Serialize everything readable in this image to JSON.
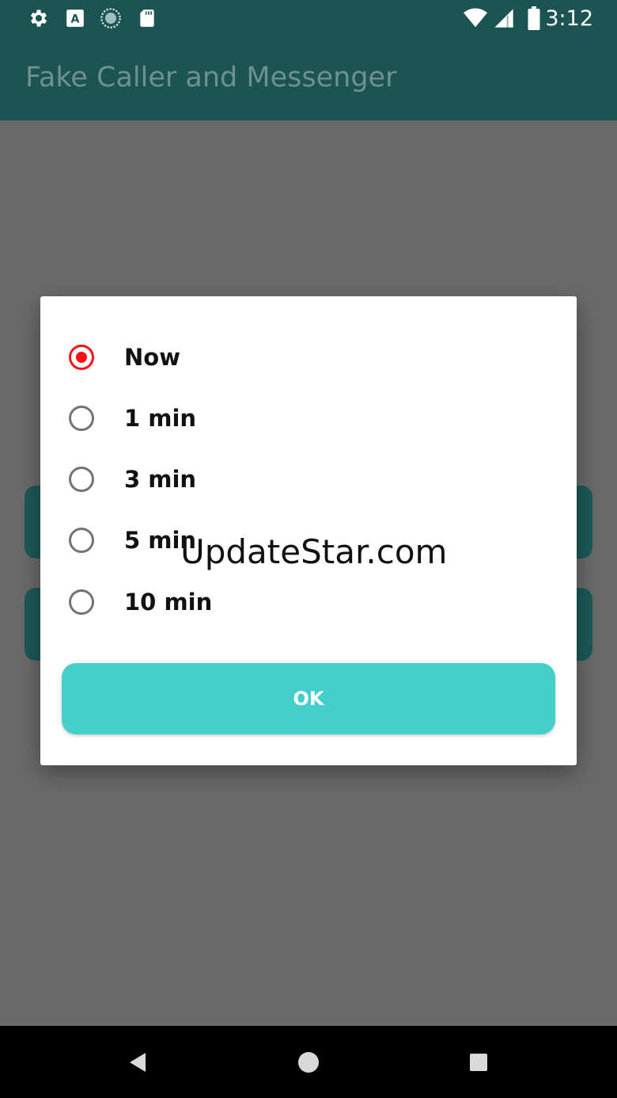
{
  "status_bar": {
    "time": "3:12",
    "icons": [
      "gear-icon",
      "a-text-icon",
      "sync-circle-icon",
      "sd-card-icon",
      "wifi-icon",
      "cell-signal-icon",
      "battery-icon"
    ]
  },
  "app_bar": {
    "title": "Fake Caller and Messenger"
  },
  "dialog": {
    "options": [
      {
        "label": "Now",
        "checked": true
      },
      {
        "label": "1 min",
        "checked": false
      },
      {
        "label": "3 min",
        "checked": false
      },
      {
        "label": "5 min",
        "checked": false
      },
      {
        "label": "10 min",
        "checked": false
      }
    ],
    "ok_label": "OK"
  },
  "watermark": "UpdateStar.com",
  "nav_bar": {
    "buttons": [
      "back-icon",
      "home-icon",
      "recents-icon"
    ]
  },
  "colors": {
    "app_bar": "#1b5453",
    "accent_radio": "#ff0f17",
    "ok_button": "#45cfcb",
    "scrim": "#6a6a6a"
  }
}
